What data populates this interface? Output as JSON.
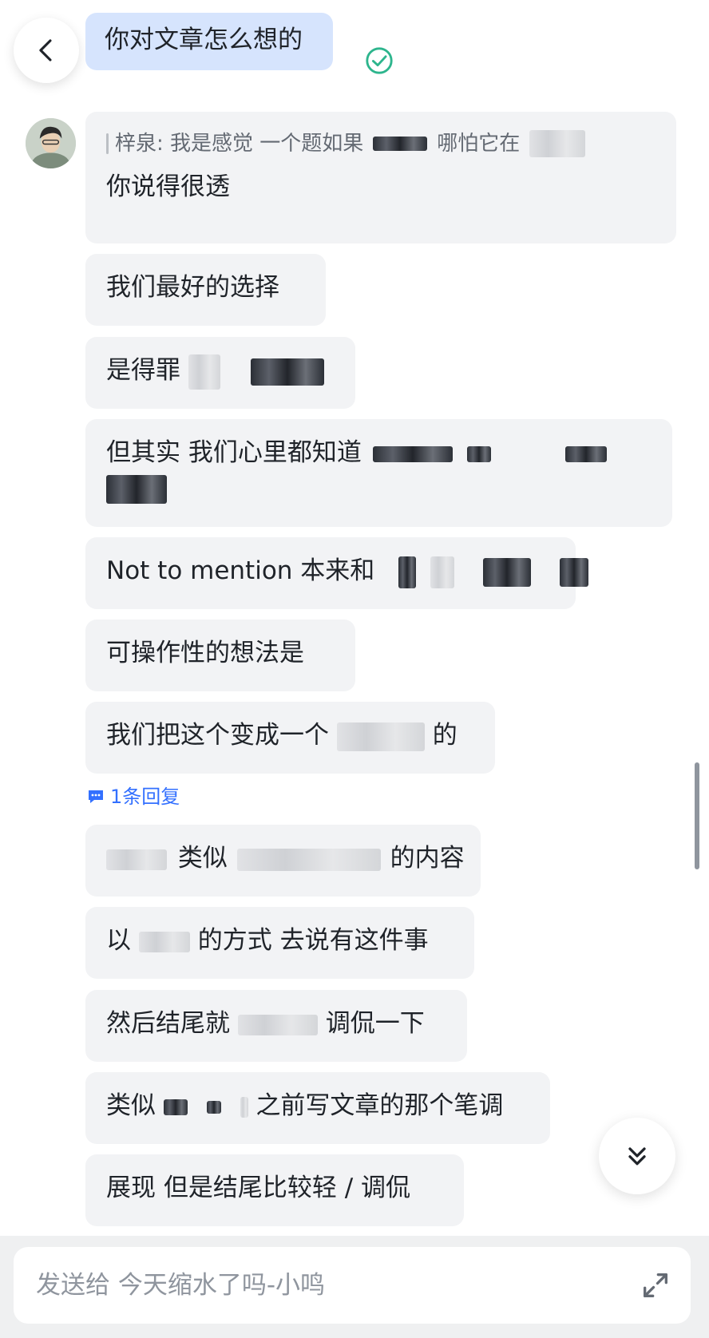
{
  "header": {
    "back_icon": "chevron-left-icon"
  },
  "messages": {
    "self_message": "你对文章怎么想的",
    "quote_text": "梓泉: 我是感觉 一个题如果",
    "quote_text_2": "哪怕它在",
    "reply_text": "你说得很透",
    "m1": "我们最好的选择",
    "m2_prefix": "是得罪",
    "m3_prefix": "但其实 我们心里都知道",
    "m4_prefix": "Not to mention 本来和",
    "m5": "可操作性的想法是",
    "m6_prefix": "我们把这个变成一个",
    "m6_suffix": "的",
    "thread_reply": "1条回复",
    "m7_mid": "类似",
    "m7_suffix": "的内容",
    "m8_prefix": "以",
    "m8_suffix": "的方式 去说有这件事",
    "m9_prefix": "然后结尾就",
    "m9_suffix": "调侃一下",
    "m10_prefix": "类似",
    "m10_suffix": "之前写文章的那个笔调",
    "m11": "展现 但是结尾比较轻 / 调侃"
  },
  "composer": {
    "placeholder": "发送给 今天缩水了吗-小鸣",
    "value": "",
    "expand_icon": "expand-icon"
  },
  "colors": {
    "self_bubble": "#d6e4fd",
    "other_bubble": "#f2f3f5",
    "accent": "#3370ff",
    "read_check": "#2db58d"
  }
}
